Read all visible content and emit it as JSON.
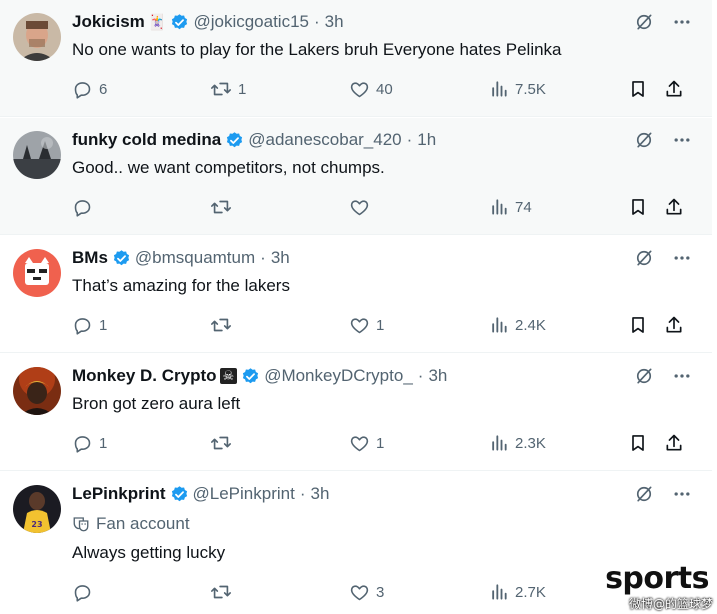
{
  "tweets": [
    {
      "name": "Jokicism",
      "emoji": "🃏",
      "handle": "@jokicgoatic15",
      "separator": "·",
      "time": "3h",
      "text": "No one wants to play for the Lakers bruh Everyone hates Pelinka",
      "replies": "6",
      "retweets": "1",
      "likes": "40",
      "views": "7.5K"
    },
    {
      "name": "funky cold medina",
      "handle": "@adanescobar_420",
      "separator": "·",
      "time": "1h",
      "text": "Good.. we want competitors, not chumps.",
      "replies": "",
      "retweets": "",
      "likes": "",
      "views": "74"
    },
    {
      "name": "BMs",
      "handle": "@bmsquamtum",
      "separator": "·",
      "time": "3h",
      "text": "That’s amazing for the lakers",
      "replies": "1",
      "retweets": "",
      "likes": "1",
      "views": "2.4K"
    },
    {
      "name": "Monkey D. Crypto",
      "emoji": "☠",
      "handle": "@MonkeyDCrypto_",
      "separator": "·",
      "time": "3h",
      "text": "Bron got zero aura left",
      "replies": "1",
      "retweets": "",
      "likes": "1",
      "views": "2.3K"
    },
    {
      "name": "LePinkprint",
      "handle": "@LePinkprint",
      "separator": "·",
      "time": "3h",
      "fan_label": "Fan account",
      "text": "Always getting lucky",
      "replies": "",
      "retweets": "",
      "likes": "3",
      "views": "2.7K"
    }
  ],
  "watermark": {
    "logo": "sports",
    "sub": "微博@的篮球梦"
  },
  "colors": {
    "verified": "#1d9bf0",
    "icon_gray": "#536471",
    "text": "#0f1419",
    "highlight_bg": "#f7f9f9"
  },
  "icons": [
    "grok-slash-icon",
    "more-icon",
    "reply-icon",
    "retweet-icon",
    "like-icon",
    "views-icon",
    "bookmark-icon",
    "share-icon",
    "verified-icon",
    "theater-mask-icon"
  ]
}
